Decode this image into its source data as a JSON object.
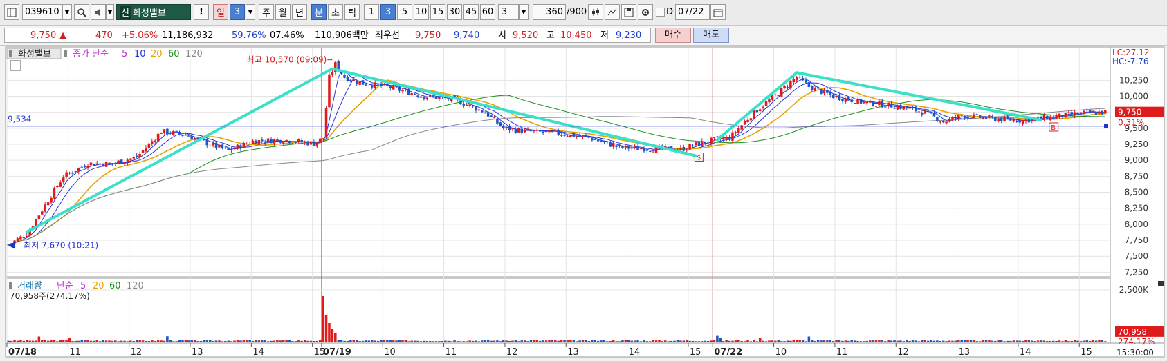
{
  "toolbar": {
    "code": "039610",
    "badge": "신",
    "stock_name": "화성밸브",
    "warn": "!",
    "period_day": "일",
    "period_day_n": "3",
    "period_week": "주",
    "period_month": "월",
    "period_year": "년",
    "period_min": "분",
    "period_sec": "초",
    "period_tick": "틱",
    "interval_buttons": [
      "1",
      "3",
      "5",
      "10",
      "15",
      "30",
      "45",
      "60"
    ],
    "interval_value": "3",
    "count_value": "360",
    "count_total": "/900",
    "d_label": "D",
    "date_value": "07/22"
  },
  "quote": {
    "price": "9,750",
    "arrow": "▲",
    "change": "470",
    "change_pct": "+5.06%",
    "volume": "11,186,932",
    "vol_ratio": "59.76%",
    "turnover": "07.46%",
    "amount": "110,906백만",
    "best_label": "최우선",
    "best_ask": "9,750",
    "best_bid": "9,740",
    "open_label": "시",
    "open": "9,520",
    "high_label": "고",
    "high": "10,450",
    "low_label": "저",
    "low": "9,230",
    "buy_label": "매수",
    "sell_label": "매도"
  },
  "chart_data": {
    "type": "candlestick",
    "title": "화성밸브",
    "legend_prefix": "종가 단순",
    "ma_periods": [
      "5",
      "10",
      "20",
      "60",
      "120"
    ],
    "ma_colors": [
      "#2233dd",
      "#2233dd",
      "#e8a300",
      "#1e8f1e",
      "#888888"
    ],
    "up_color": "#e01b1b",
    "down_color": "#1f55c8",
    "trend_color": "#3be0c8",
    "ylim": [
      7200,
      10750
    ],
    "y_ticks": [
      10250,
      10000,
      9750,
      9500,
      9250,
      9000,
      8750,
      8500,
      8250,
      8000,
      7750,
      7500,
      7250
    ],
    "y_tick_labels": [
      "10,250",
      "10,000",
      "9,750",
      "9,500",
      "9,250",
      "9,000",
      "8,750",
      "8,500",
      "8,250",
      "8,000",
      "7,750",
      "7,500",
      "7,250"
    ],
    "n_bars": 360,
    "x_ticks": [
      {
        "bar": 0,
        "label": "07/18",
        "bold": true
      },
      {
        "bar": 20,
        "label": "11"
      },
      {
        "bar": 40,
        "label": "12"
      },
      {
        "bar": 60,
        "label": "13"
      },
      {
        "bar": 80,
        "label": "14"
      },
      {
        "bar": 100,
        "label": "15"
      },
      {
        "bar": 103,
        "label": "07/19",
        "bold": true
      },
      {
        "bar": 123,
        "label": "10"
      },
      {
        "bar": 143,
        "label": "11"
      },
      {
        "bar": 163,
        "label": "12"
      },
      {
        "bar": 183,
        "label": "13"
      },
      {
        "bar": 203,
        "label": "14"
      },
      {
        "bar": 223,
        "label": "15"
      },
      {
        "bar": 231,
        "label": "07/22",
        "bold": true
      },
      {
        "bar": 251,
        "label": "10"
      },
      {
        "bar": 271,
        "label": "11"
      },
      {
        "bar": 291,
        "label": "12"
      },
      {
        "bar": 311,
        "label": "13"
      },
      {
        "bar": 331,
        "label": "14"
      },
      {
        "bar": 351,
        "label": "15"
      }
    ],
    "time_label": "15:30:00",
    "day_separators": [
      103,
      231
    ],
    "price_anchors": [
      [
        0,
        7680
      ],
      [
        6,
        7850
      ],
      [
        12,
        8300
      ],
      [
        18,
        8750
      ],
      [
        26,
        8950
      ],
      [
        34,
        8950
      ],
      [
        42,
        9050
      ],
      [
        50,
        9450
      ],
      [
        58,
        9400
      ],
      [
        66,
        9250
      ],
      [
        72,
        9150
      ],
      [
        80,
        9300
      ],
      [
        90,
        9320
      ],
      [
        100,
        9260
      ],
      [
        103,
        9350
      ],
      [
        105,
        10300
      ],
      [
        107,
        10500
      ],
      [
        110,
        10300
      ],
      [
        116,
        10200
      ],
      [
        124,
        10150
      ],
      [
        136,
        10000
      ],
      [
        146,
        9950
      ],
      [
        156,
        9750
      ],
      [
        162,
        9500
      ],
      [
        170,
        9450
      ],
      [
        180,
        9420
      ],
      [
        190,
        9350
      ],
      [
        200,
        9200
      ],
      [
        210,
        9180
      ],
      [
        220,
        9170
      ],
      [
        226,
        9260
      ],
      [
        231,
        9320
      ],
      [
        236,
        9350
      ],
      [
        244,
        9750
      ],
      [
        252,
        10050
      ],
      [
        258,
        10300
      ],
      [
        262,
        10150
      ],
      [
        270,
        10000
      ],
      [
        280,
        9900
      ],
      [
        290,
        9850
      ],
      [
        300,
        9750
      ],
      [
        306,
        9600
      ],
      [
        312,
        9700
      ],
      [
        322,
        9650
      ],
      [
        332,
        9620
      ],
      [
        342,
        9680
      ],
      [
        352,
        9740
      ],
      [
        359,
        9750
      ]
    ],
    "trend_lines": [
      [
        [
          6,
          7880
        ],
        [
          106,
          10430
        ]
      ],
      [
        [
          106,
          10430
        ],
        [
          225,
          9070
        ]
      ],
      [
        [
          232,
          9320
        ],
        [
          258,
          10370
        ]
      ],
      [
        [
          258,
          10370
        ],
        [
          338,
          9630
        ]
      ]
    ],
    "hline": {
      "value": 9534,
      "label": "9,534"
    },
    "high_annotation": {
      "text": "최고 10,570 (09:09)",
      "bar": 106,
      "value": 10570
    },
    "low_annotation": {
      "text": "최저 7,670 (10:21)",
      "bar": 0,
      "value": 7670
    },
    "lc_label": "LC:27.12",
    "hc_label": "HC:-7.76",
    "last_price_label": "9,750",
    "last_pct_label": "0.31%",
    "signal_b": "B",
    "signal_s": "S",
    "volume_panel": {
      "title": "거래량",
      "legend_prefix": "단순",
      "ma_periods": [
        "5",
        "20",
        "60",
        "120"
      ],
      "info": "70,958주(274.17%)",
      "ylim": [
        0,
        3000000
      ],
      "y_tick": 2500000,
      "y_tick_label": "2,500K",
      "last_volume_label": "70,958",
      "last_pct_label": "274.17%",
      "spike_bars": [
        [
          103,
          2200000
        ],
        [
          104,
          1300000
        ],
        [
          105,
          900000
        ],
        [
          106,
          600000
        ],
        [
          107,
          400000
        ],
        [
          52,
          260000
        ],
        [
          232,
          280000
        ],
        [
          233,
          180000
        ],
        [
          262,
          250000
        ],
        [
          246,
          200000
        ],
        [
          10,
          250000
        ],
        [
          20,
          180000
        ]
      ]
    }
  }
}
